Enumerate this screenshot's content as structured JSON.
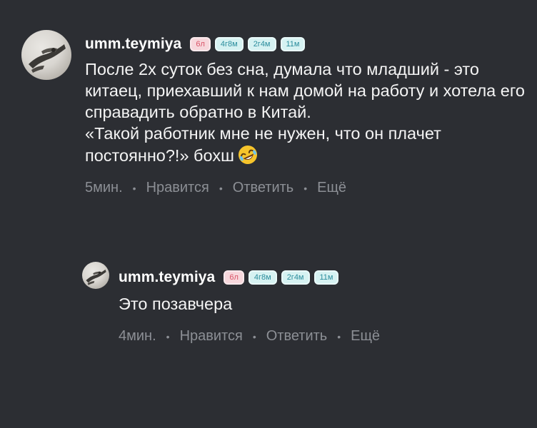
{
  "comments": [
    {
      "username": "umm.teymiya",
      "badges": [
        "6л",
        "4г8м",
        "2г4м",
        "11м"
      ],
      "text_lines": [
        "После 2х суток без сна, думала что младший - это китаец, приехавший к нам домой на работу и хотела его справадить обратно в Китай.",
        "«Такой работник мне не нужен, что он плачет постоянно?!» бохш"
      ],
      "emoji": "rolling-on-floor-laughing-emoji",
      "time": "5мин.",
      "like_label": "Нравится",
      "reply_label": "Ответить",
      "more_label": "Ещё"
    },
    {
      "username": "umm.teymiya",
      "badges": [
        "6л",
        "4г8м",
        "2г4м",
        "11м"
      ],
      "text_lines": [
        "Это позавчера"
      ],
      "time": "4мин.",
      "like_label": "Нравится",
      "reply_label": "Ответить",
      "more_label": "Ещё"
    }
  ],
  "colors": {
    "background": "#2c2e33",
    "meta_text": "#8c8f95",
    "badge_pink_bg": "#f7d7dc",
    "badge_pink_text": "#d95569",
    "badge_cyan_bg": "#d6f2f2",
    "badge_cyan_text": "#2b8d9d"
  }
}
